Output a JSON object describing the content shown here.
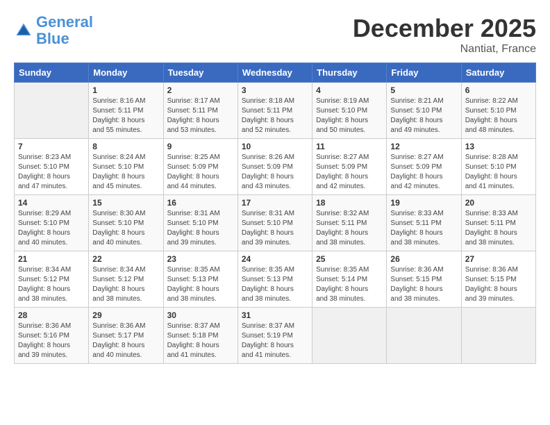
{
  "header": {
    "logo_line1": "General",
    "logo_line2": "Blue",
    "month": "December 2025",
    "location": "Nantiat, France"
  },
  "days_of_week": [
    "Sunday",
    "Monday",
    "Tuesday",
    "Wednesday",
    "Thursday",
    "Friday",
    "Saturday"
  ],
  "weeks": [
    [
      {
        "day": "",
        "info": ""
      },
      {
        "day": "1",
        "info": "Sunrise: 8:16 AM\nSunset: 5:11 PM\nDaylight: 8 hours\nand 55 minutes."
      },
      {
        "day": "2",
        "info": "Sunrise: 8:17 AM\nSunset: 5:11 PM\nDaylight: 8 hours\nand 53 minutes."
      },
      {
        "day": "3",
        "info": "Sunrise: 8:18 AM\nSunset: 5:11 PM\nDaylight: 8 hours\nand 52 minutes."
      },
      {
        "day": "4",
        "info": "Sunrise: 8:19 AM\nSunset: 5:10 PM\nDaylight: 8 hours\nand 50 minutes."
      },
      {
        "day": "5",
        "info": "Sunrise: 8:21 AM\nSunset: 5:10 PM\nDaylight: 8 hours\nand 49 minutes."
      },
      {
        "day": "6",
        "info": "Sunrise: 8:22 AM\nSunset: 5:10 PM\nDaylight: 8 hours\nand 48 minutes."
      }
    ],
    [
      {
        "day": "7",
        "info": "Sunrise: 8:23 AM\nSunset: 5:10 PM\nDaylight: 8 hours\nand 47 minutes."
      },
      {
        "day": "8",
        "info": "Sunrise: 8:24 AM\nSunset: 5:10 PM\nDaylight: 8 hours\nand 45 minutes."
      },
      {
        "day": "9",
        "info": "Sunrise: 8:25 AM\nSunset: 5:09 PM\nDaylight: 8 hours\nand 44 minutes."
      },
      {
        "day": "10",
        "info": "Sunrise: 8:26 AM\nSunset: 5:09 PM\nDaylight: 8 hours\nand 43 minutes."
      },
      {
        "day": "11",
        "info": "Sunrise: 8:27 AM\nSunset: 5:09 PM\nDaylight: 8 hours\nand 42 minutes."
      },
      {
        "day": "12",
        "info": "Sunrise: 8:27 AM\nSunset: 5:09 PM\nDaylight: 8 hours\nand 42 minutes."
      },
      {
        "day": "13",
        "info": "Sunrise: 8:28 AM\nSunset: 5:10 PM\nDaylight: 8 hours\nand 41 minutes."
      }
    ],
    [
      {
        "day": "14",
        "info": "Sunrise: 8:29 AM\nSunset: 5:10 PM\nDaylight: 8 hours\nand 40 minutes."
      },
      {
        "day": "15",
        "info": "Sunrise: 8:30 AM\nSunset: 5:10 PM\nDaylight: 8 hours\nand 40 minutes."
      },
      {
        "day": "16",
        "info": "Sunrise: 8:31 AM\nSunset: 5:10 PM\nDaylight: 8 hours\nand 39 minutes."
      },
      {
        "day": "17",
        "info": "Sunrise: 8:31 AM\nSunset: 5:10 PM\nDaylight: 8 hours\nand 39 minutes."
      },
      {
        "day": "18",
        "info": "Sunrise: 8:32 AM\nSunset: 5:11 PM\nDaylight: 8 hours\nand 38 minutes."
      },
      {
        "day": "19",
        "info": "Sunrise: 8:33 AM\nSunset: 5:11 PM\nDaylight: 8 hours\nand 38 minutes."
      },
      {
        "day": "20",
        "info": "Sunrise: 8:33 AM\nSunset: 5:11 PM\nDaylight: 8 hours\nand 38 minutes."
      }
    ],
    [
      {
        "day": "21",
        "info": "Sunrise: 8:34 AM\nSunset: 5:12 PM\nDaylight: 8 hours\nand 38 minutes."
      },
      {
        "day": "22",
        "info": "Sunrise: 8:34 AM\nSunset: 5:12 PM\nDaylight: 8 hours\nand 38 minutes."
      },
      {
        "day": "23",
        "info": "Sunrise: 8:35 AM\nSunset: 5:13 PM\nDaylight: 8 hours\nand 38 minutes."
      },
      {
        "day": "24",
        "info": "Sunrise: 8:35 AM\nSunset: 5:13 PM\nDaylight: 8 hours\nand 38 minutes."
      },
      {
        "day": "25",
        "info": "Sunrise: 8:35 AM\nSunset: 5:14 PM\nDaylight: 8 hours\nand 38 minutes."
      },
      {
        "day": "26",
        "info": "Sunrise: 8:36 AM\nSunset: 5:15 PM\nDaylight: 8 hours\nand 38 minutes."
      },
      {
        "day": "27",
        "info": "Sunrise: 8:36 AM\nSunset: 5:15 PM\nDaylight: 8 hours\nand 39 minutes."
      }
    ],
    [
      {
        "day": "28",
        "info": "Sunrise: 8:36 AM\nSunset: 5:16 PM\nDaylight: 8 hours\nand 39 minutes."
      },
      {
        "day": "29",
        "info": "Sunrise: 8:36 AM\nSunset: 5:17 PM\nDaylight: 8 hours\nand 40 minutes."
      },
      {
        "day": "30",
        "info": "Sunrise: 8:37 AM\nSunset: 5:18 PM\nDaylight: 8 hours\nand 41 minutes."
      },
      {
        "day": "31",
        "info": "Sunrise: 8:37 AM\nSunset: 5:19 PM\nDaylight: 8 hours\nand 41 minutes."
      },
      {
        "day": "",
        "info": ""
      },
      {
        "day": "",
        "info": ""
      },
      {
        "day": "",
        "info": ""
      }
    ]
  ]
}
